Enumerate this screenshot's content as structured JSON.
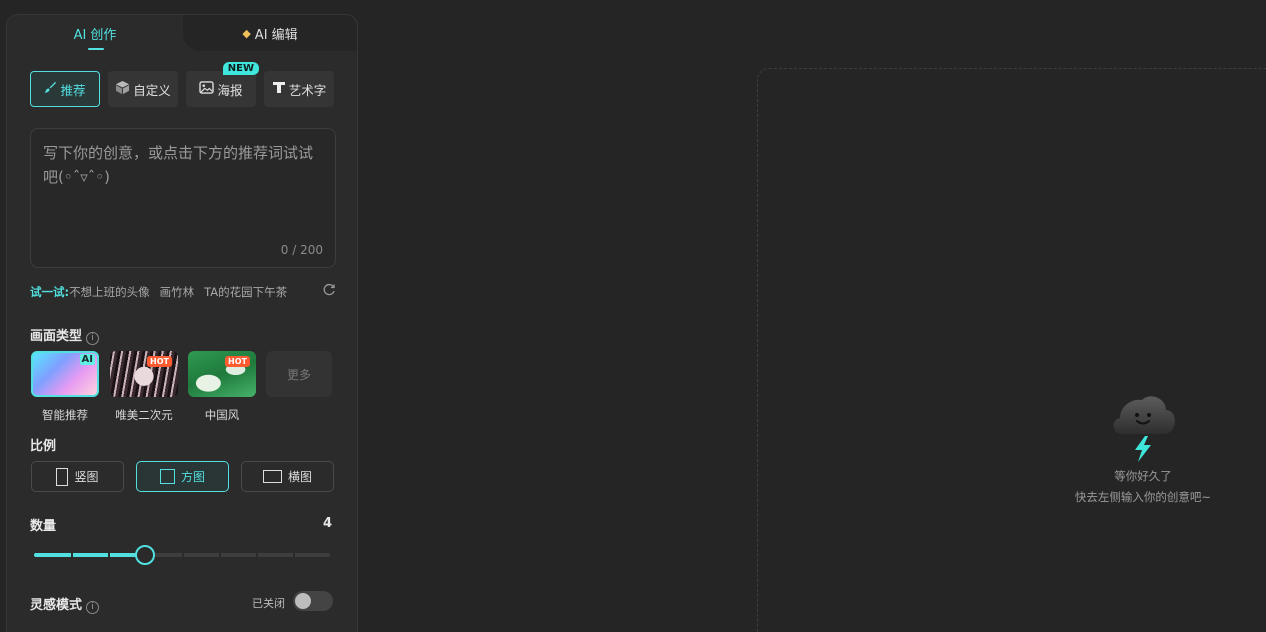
{
  "tabs": {
    "ai_create": "AI 创作",
    "ai_edit": "AI 编辑",
    "ai_edit_icon": "diamond-icon"
  },
  "modes": [
    {
      "label": "推荐",
      "icon": "brush-icon",
      "active": true
    },
    {
      "label": "自定义",
      "icon": "cube-icon",
      "active": false
    },
    {
      "label": "海报",
      "icon": "image-icon",
      "active": false,
      "badge": "NEW"
    },
    {
      "label": "艺术字",
      "icon": "font-icon",
      "active": false
    }
  ],
  "prompt": {
    "placeholder": "写下你的创意，或点击下方的推荐词试试吧(◦ˆ▿ˆ◦)",
    "counter": "0 / 200"
  },
  "suggest": {
    "label": "试一试:",
    "items": [
      "不想上班的头像",
      "画竹林",
      "TA的花园下午茶"
    ],
    "refresh_icon": "refresh-icon"
  },
  "style_section": {
    "title": "画面类型",
    "styles": [
      {
        "label": "智能推荐",
        "selected": true,
        "corner": "AI"
      },
      {
        "label": "唯美二次元",
        "selected": false,
        "badge": "HOT"
      },
      {
        "label": "中国风",
        "selected": false,
        "badge": "HOT"
      }
    ],
    "more": "更多"
  },
  "ratio_section": {
    "title": "比例",
    "ratios": [
      {
        "label": "竖图",
        "active": false
      },
      {
        "label": "方图",
        "active": true
      },
      {
        "label": "横图",
        "active": false
      }
    ]
  },
  "quantity": {
    "title": "数量",
    "value": "4",
    "min": 1,
    "max": 8,
    "current": 4
  },
  "inspire": {
    "title": "灵感模式",
    "state": "已关闭",
    "on": false
  },
  "empty_state": {
    "line1": "等你好久了",
    "line2": "快去左侧输入你的创意吧~"
  },
  "colors": {
    "accent": "#52e0e0",
    "hot": "#ff5b30",
    "background": "#252525",
    "panel": "#2b2b2b"
  }
}
